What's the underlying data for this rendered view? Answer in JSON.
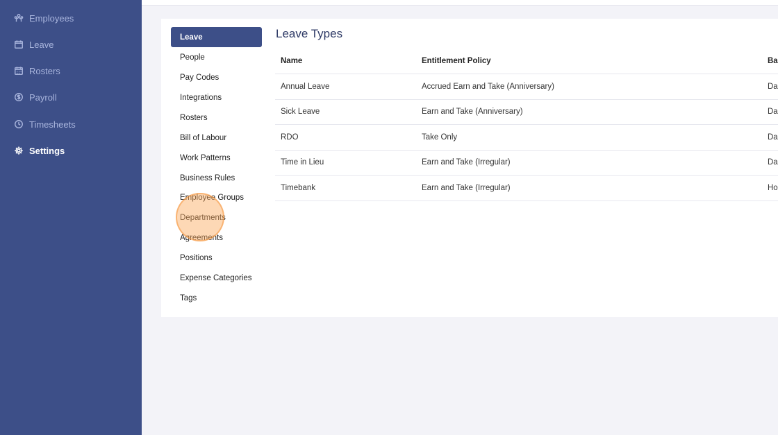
{
  "sidebar": {
    "items": [
      {
        "label": "Employees",
        "icon": "employees-icon"
      },
      {
        "label": "Leave",
        "icon": "calendar-icon"
      },
      {
        "label": "Rosters",
        "icon": "calendar-grid-icon"
      },
      {
        "label": "Payroll",
        "icon": "dollar-circle-icon"
      },
      {
        "label": "Timesheets",
        "icon": "clock-icon"
      },
      {
        "label": "Settings",
        "icon": "gear-icon",
        "active": true
      }
    ]
  },
  "subnav": {
    "items": [
      "Leave",
      "People",
      "Pay Codes",
      "Integrations",
      "Rosters",
      "Bill of Labour",
      "Work Patterns",
      "Business Rules",
      "Employee Groups",
      "Departments",
      "Agreements",
      "Positions",
      "Expense Categories",
      "Tags"
    ],
    "active_index": 0
  },
  "main": {
    "title": "Leave Types",
    "table": {
      "headers": [
        "Name",
        "Entitlement Policy",
        "Ba"
      ],
      "rows": [
        [
          "Annual Leave",
          "Accrued Earn and Take (Anniversary)",
          "Da"
        ],
        [
          "Sick Leave",
          "Earn and Take (Anniversary)",
          "Da"
        ],
        [
          "RDO",
          "Take Only",
          "Da"
        ],
        [
          "Time in Lieu",
          "Earn and Take (Irregular)",
          "Da"
        ],
        [
          "Timebank",
          "Earn and Take (Irregular)",
          "Ho"
        ]
      ]
    }
  },
  "colors": {
    "sidebar_bg": "#3d4f88",
    "accent": "#3d4f88",
    "click_highlight": "#faa85a"
  }
}
